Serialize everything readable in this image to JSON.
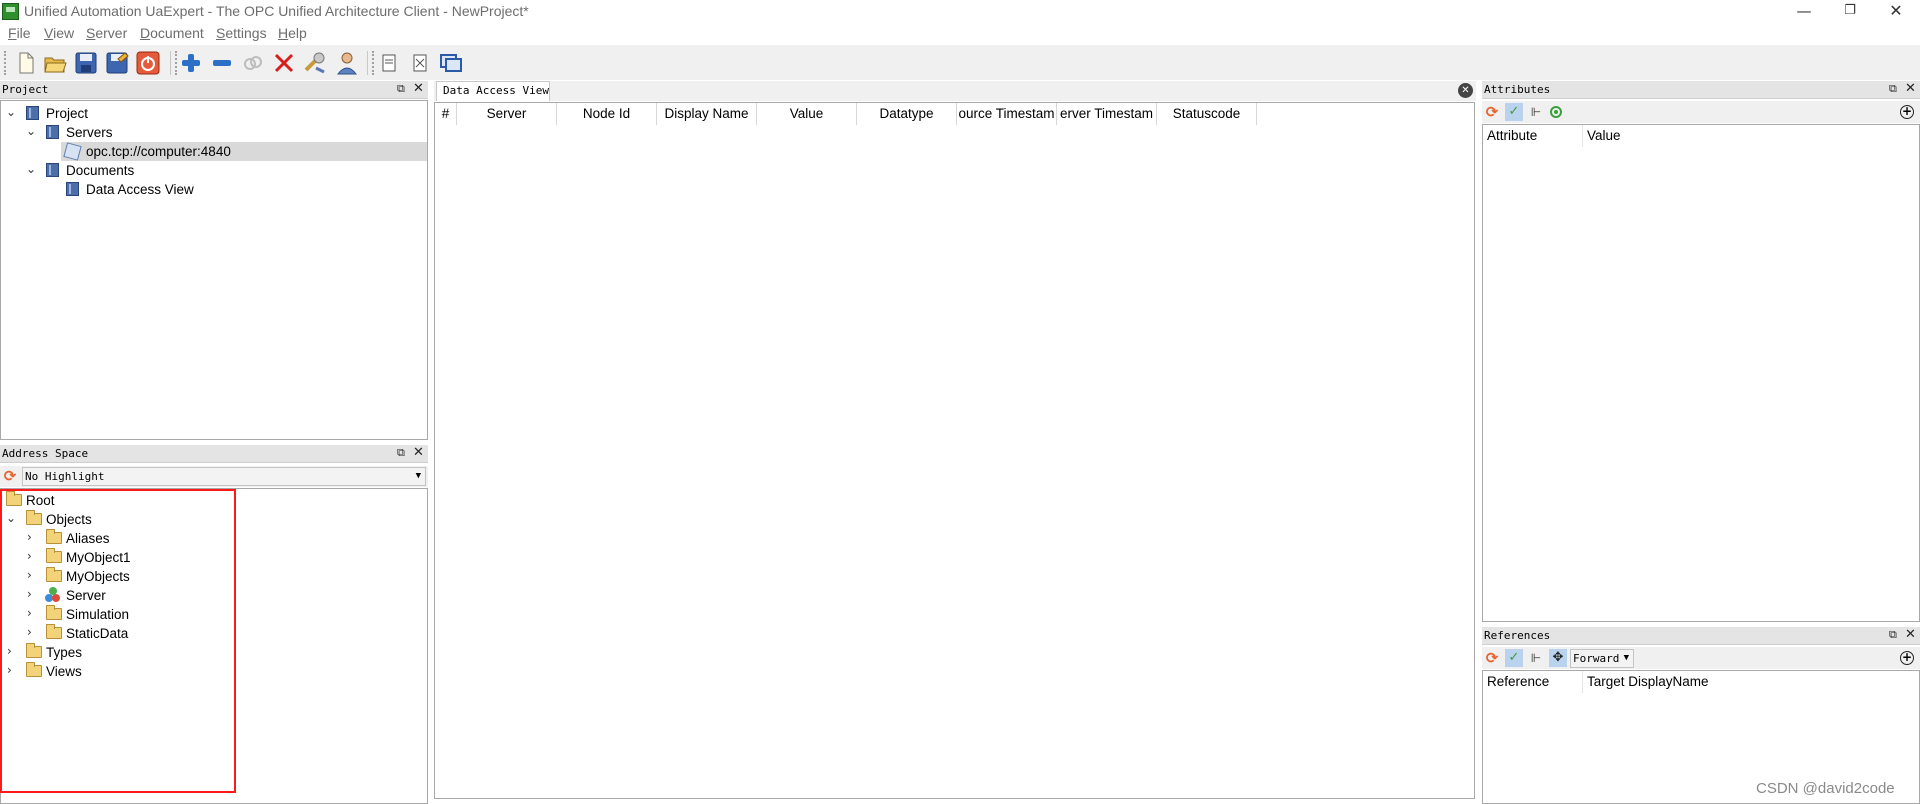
{
  "window": {
    "title": "Unified Automation UaExpert - The OPC Unified Architecture Client - NewProject*",
    "minimize_glyph": "—",
    "restore_glyph": "❐",
    "close_glyph": "✕"
  },
  "menu": [
    {
      "label": "File",
      "mnemonic": "F"
    },
    {
      "label": "View",
      "mnemonic": "V"
    },
    {
      "label": "Server",
      "mnemonic": "S"
    },
    {
      "label": "Document",
      "mnemonic": "D"
    },
    {
      "label": "Settings",
      "mnemonic": "S"
    },
    {
      "label": "Help",
      "mnemonic": "H"
    }
  ],
  "toolbar_icons": [
    "new-project-icon",
    "open-project-icon",
    "save-project-icon",
    "save-as-icon",
    "disconnect-all-icon",
    "add-server-icon",
    "remove-server-icon",
    "connect-icon",
    "delete-icon",
    "settings-wrench-icon",
    "user-icon",
    "add-document-icon",
    "remove-document-icon",
    "windows-icon"
  ],
  "project_panel": {
    "title": "Project",
    "tree": {
      "project": "Project",
      "servers": "Servers",
      "server_endpoint": "opc.tcp://computer:4840",
      "documents": "Documents",
      "data_access_view": "Data Access View"
    }
  },
  "address_space_panel": {
    "title": "Address Space",
    "highlight_select": "No Highlight",
    "tree": {
      "root": "Root",
      "objects": "Objects",
      "aliases": "Aliases",
      "myobject1": "MyObject1",
      "myobjects": "MyObjects",
      "server": "Server",
      "simulation": "Simulation",
      "staticdata": "StaticData",
      "types": "Types",
      "views": "Views"
    }
  },
  "data_access_view": {
    "tab_label": "Data Access View",
    "columns": [
      "#",
      "Server",
      "Node Id",
      "Display Name",
      "Value",
      "Datatype",
      "ource Timestam",
      "erver Timestam",
      "Statuscode"
    ]
  },
  "attributes_panel": {
    "title": "Attributes",
    "columns": [
      "Attribute",
      "Value"
    ]
  },
  "references_panel": {
    "title": "References",
    "direction_select": "Forward",
    "columns": [
      "Reference",
      "Target DisplayName"
    ]
  },
  "watermark": "CSDN @david2code",
  "colors": {
    "highlight_box": "#ff1a1a",
    "panel_header": "#e4e4e4",
    "toolbar_bg": "#f0f0f0",
    "selection_bg": "#d9d9d9"
  }
}
